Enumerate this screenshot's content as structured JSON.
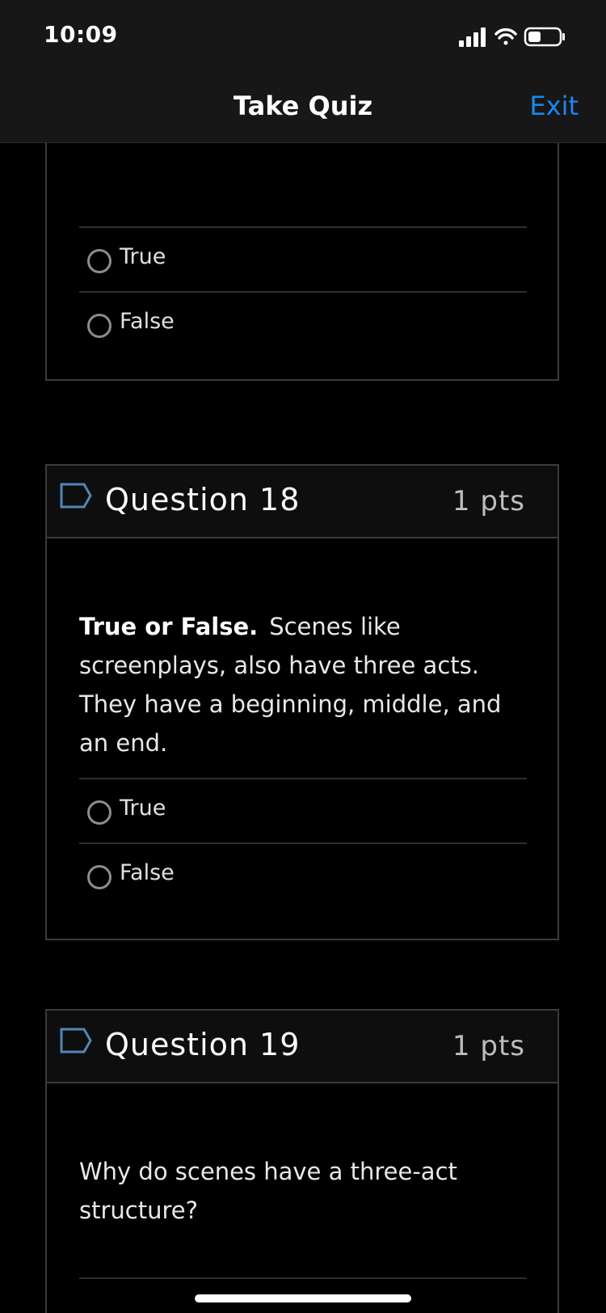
{
  "status_bar": {
    "time": "10:09"
  },
  "nav": {
    "title": "Take Quiz",
    "exit_label": "Exit",
    "exit_color": "#1c86f2"
  },
  "question_17_partial": {
    "options": [
      "True",
      "False"
    ]
  },
  "question_18": {
    "title": "Question 18",
    "points": "1 pts",
    "lead": "True or False.",
    "text": "Scenes like screenplays, also have three acts. They have a beginning, middle, and an end.",
    "options": [
      "True",
      "False"
    ]
  },
  "question_19": {
    "title": "Question 19",
    "points": "1 pts",
    "text": "Why do scenes have a three-act structure?"
  },
  "icons": {
    "flag": "flag-outline-icon",
    "radio": "radio-unselected-icon",
    "signal": "cellular-signal-icon",
    "wifi": "wifi-icon",
    "battery": "battery-icon"
  }
}
